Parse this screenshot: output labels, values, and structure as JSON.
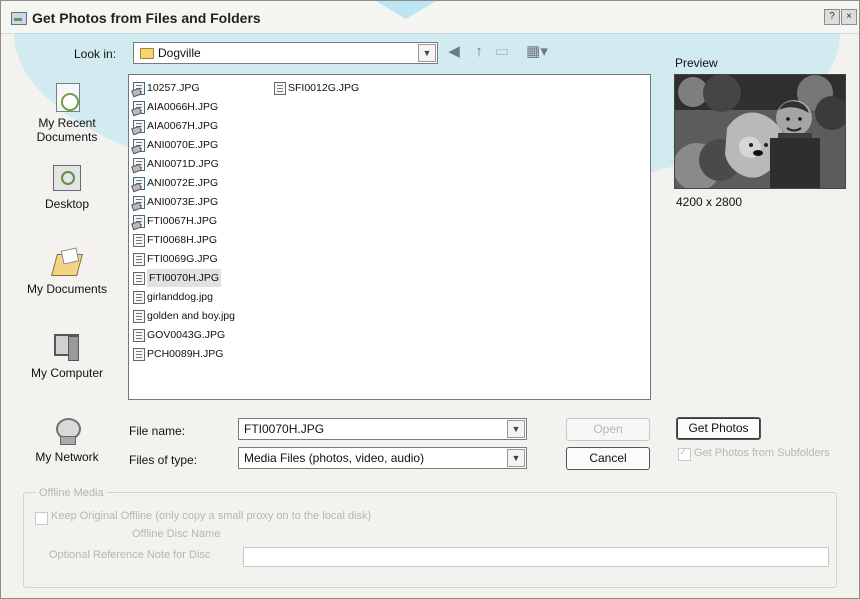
{
  "window": {
    "title": "Get Photos from Files and Folders",
    "help_label": "?",
    "close_label": "×"
  },
  "lookin": {
    "label": "Look in:",
    "value": "Dogville"
  },
  "toolbar": {
    "back_icon": "back-icon",
    "up_icon": "up-folder-icon",
    "new_folder_icon": "new-folder-icon",
    "view_menu_icon": "view-menu-icon"
  },
  "preview": {
    "label": "Preview",
    "dimensions": "4200 x 2800"
  },
  "places": [
    {
      "label": "My Recent Documents",
      "icon": "recent-documents-icon"
    },
    {
      "label": "Desktop",
      "icon": "desktop-icon"
    },
    {
      "label": "My Documents",
      "icon": "my-documents-icon"
    },
    {
      "label": "My Computer",
      "icon": "my-computer-icon"
    },
    {
      "label": "My Network",
      "icon": "my-network-icon"
    }
  ],
  "files": {
    "col1": [
      "10257.JPG",
      "AIA0066H.JPG",
      "AIA0067H.JPG",
      "ANI0070E.JPG",
      "ANI0071D.JPG",
      "ANI0072E.JPG",
      "ANI0073E.JPG",
      "FTI0067H.JPG",
      "FTI0068H.JPG",
      "FTI0069G.JPG",
      "FTI0070H.JPG",
      "girlanddog.jpg",
      "golden and boy.jpg",
      "GOV0043G.JPG",
      "PCH0089H.JPG"
    ],
    "col2": [
      "SFI0012G.JPG"
    ],
    "selected": "FTI0070H.JPG"
  },
  "filename": {
    "label": "File name:",
    "value": "FTI0070H.JPG"
  },
  "filetype": {
    "label": "Files of type:",
    "value": "Media Files (photos, video, audio)"
  },
  "buttons": {
    "open": "Open",
    "cancel": "Cancel",
    "get_photos": "Get Photos"
  },
  "subfolders": {
    "label": "Get Photos from Subfolders",
    "checked": true
  },
  "offline": {
    "group_title": "Offline Media",
    "keep_original_label": "Keep Original Offline (only copy a small proxy on to the local disk)",
    "disc_name_label": "Offline Disc Name",
    "reference_label": "Optional Reference Note for Disc",
    "reference_value": ""
  },
  "colors": {
    "overlay": "#a8e0f4",
    "window_bg": "#f3f2ee"
  }
}
